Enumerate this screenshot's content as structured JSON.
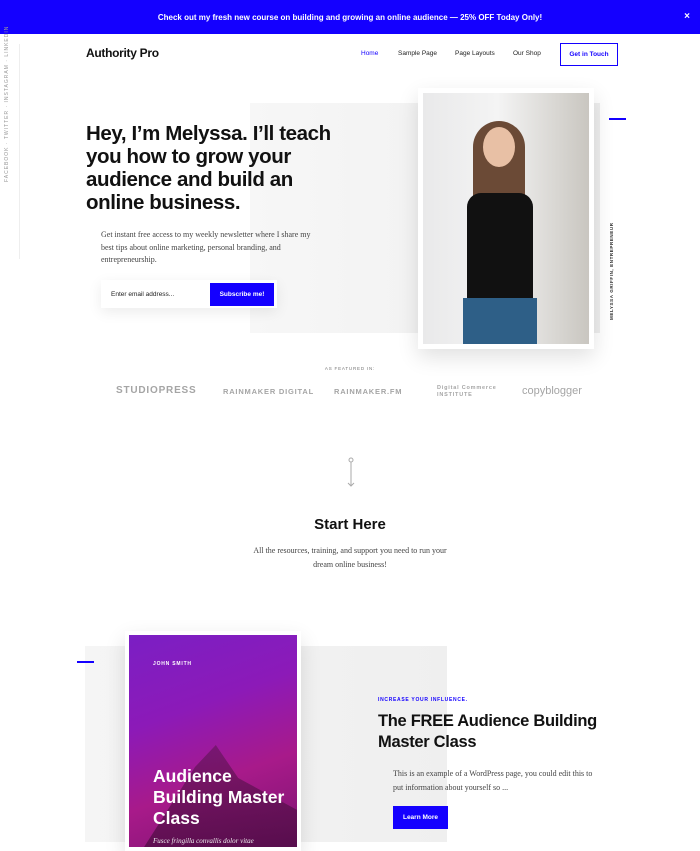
{
  "banner": {
    "text": "Check out my fresh new course on building and growing an online audience — 25% OFF Today Only!",
    "close": "×"
  },
  "social": {
    "text": "FACEBOOK · TWITTER · INSTAGRAM · LINKEDIN"
  },
  "header": {
    "logo": "Authority Pro",
    "nav": [
      "Home",
      "Sample Page",
      "Page Layouts",
      "Our Shop"
    ],
    "active": "Home",
    "cta": "Get in Touch"
  },
  "hero": {
    "headline": "Hey, I’m Melyssa. I’ll teach you how to grow your audience and build an online business.",
    "intro": "Get instant free access to my weekly newsletter where I share my best tips about online marketing, personal branding, and entrepreneurship.",
    "email_placeholder": "Enter email address...",
    "subscribe": "Subscribe me!",
    "caption": "MELYSSA GRIFFIN, ENTREPRENEUR"
  },
  "featured": {
    "label": "AS FEATURED IN:",
    "logos": [
      "STUDIOPRESS",
      "RAINMAKER DIGITAL",
      "RAINMAKER.FM",
      "Digital Commerce INSTITUTE",
      "copyblogger"
    ]
  },
  "start": {
    "title": "Start Here",
    "text": "All the resources, training, and support you need to run your dream online business!"
  },
  "course": {
    "book_author": "JOHN SMITH",
    "book_title": "Audience Building Master Class",
    "book_subtitle": "Fusce fringilla convallis dolor vitae",
    "kicker": "INCREASE YOUR INFLUENCE.",
    "title": "The FREE Audience Building Master Class",
    "text": "This is an example of a WordPress page, you could edit this to put information about yourself so ...",
    "button": "Learn More"
  },
  "colors": {
    "accent": "#1400ff"
  }
}
